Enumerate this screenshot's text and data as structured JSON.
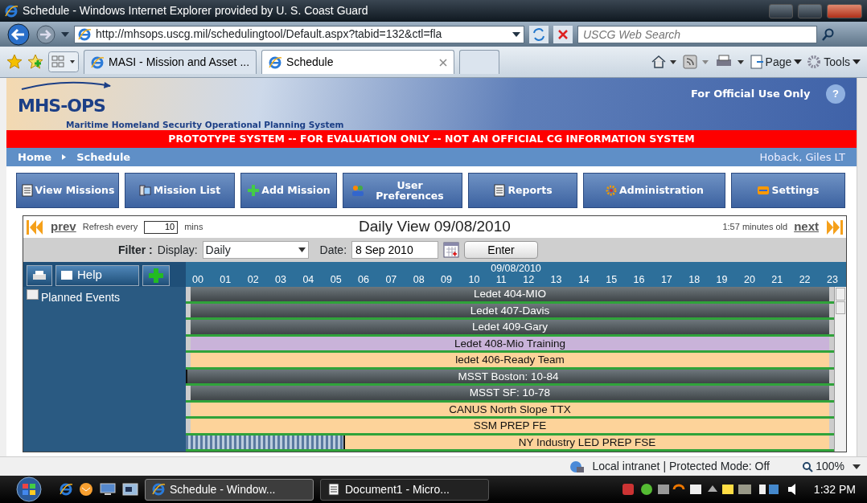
{
  "browser": {
    "title": "Schedule - Windows Internet Explorer provided by U. S. Coast Guard",
    "address": "http://mhsops.uscg.mil/schedulingtool/Default.aspx?tabid=132&ctl=fla",
    "search_placeholder": "USCG Web Search",
    "tabs": [
      {
        "label": "MASI - Mission and Asset ...",
        "selected": false
      },
      {
        "label": "Schedule",
        "selected": true
      }
    ],
    "commands": [
      "Page",
      "Tools"
    ]
  },
  "header": {
    "logo": "MHS-OPS",
    "subtitle": "Maritime Homeland Security Operational Planning System",
    "notice": "For Official Use Only",
    "help": "?"
  },
  "banner": "PROTOTYPE SYSTEM -- FOR EVALUATION ONLY -- NOT AN OFFICIAL CG INFORMATION SYSTEM",
  "breadcrumb": [
    "Home",
    "Schedule"
  ],
  "user": "Hoback, Giles LT",
  "nav": [
    {
      "label": "View Missions"
    },
    {
      "label": "Mission List"
    },
    {
      "label": "Add Mission"
    },
    {
      "label": "User Preferences"
    },
    {
      "label": "Reports"
    },
    {
      "label": "Administration"
    },
    {
      "label": "Settings"
    }
  ],
  "schedule": {
    "prev": "prev",
    "refresh_label": "Refresh every",
    "refresh_value": "10",
    "refresh_unit": "mins",
    "title": "Daily View 09/08/2010",
    "age": "1:57 minutes old",
    "next": "next",
    "filter": {
      "label": "Filter :",
      "display_label": "Display:",
      "display_value": "Daily",
      "date_label": "Date:",
      "date_value": "8 Sep 2010",
      "enter": "Enter"
    },
    "help": "Help",
    "timeline_date": "09/08/2010",
    "hours": [
      "00",
      "01",
      "02",
      "03",
      "04",
      "05",
      "06",
      "07",
      "08",
      "09",
      "10",
      "11",
      "12",
      "13",
      "14",
      "15",
      "16",
      "17",
      "18",
      "19",
      "20",
      "21",
      "22",
      "23"
    ],
    "group": {
      "label": "Planned Events",
      "checked": false
    },
    "events": [
      {
        "name": "Ledet 404-MIO",
        "color": "#6e777c",
        "kind": "bar",
        "continues_left": true
      },
      {
        "name": "Ledet 407-Davis",
        "color": "#6e777c",
        "kind": "bar",
        "continues_left": true
      },
      {
        "name": "Ledet 409-Gary",
        "color": "#6e777c",
        "kind": "bar",
        "continues_left": true
      },
      {
        "name": "Ledet 408-Mio Training",
        "color": "#c9b3d9",
        "kind": "bar",
        "continues_left": true
      },
      {
        "name": "ledet 406-Ready Team",
        "color": "#fdd39a",
        "kind": "bar",
        "continues_left": true
      },
      {
        "name": "MSST Boston: 10-84",
        "color": "#6e777c",
        "kind": "bar",
        "continues_left": false
      },
      {
        "name": "MSST SF: 10-78",
        "color": "#6e777c",
        "kind": "bar",
        "continues_left": true
      },
      {
        "name": "CANUS North Slope TTX",
        "color": "#fdd39a",
        "kind": "bar",
        "continues_left": true
      },
      {
        "name": "SSM PREP FE",
        "color": "#fdd39a",
        "kind": "bar",
        "continues_left": true
      },
      {
        "name": "NY Industry LED PREP FSE",
        "color": "#fdd39a",
        "kind": "partial",
        "continues_left": false
      }
    ]
  },
  "status": {
    "zone": "Local intranet | Protected Mode: Off",
    "zoom": "100%"
  },
  "taskbar": {
    "windows": [
      {
        "label": "Schedule - Window...",
        "selected": true
      },
      {
        "label": "Document1 - Micro...",
        "selected": false
      }
    ],
    "time": "1:32 PM"
  }
}
